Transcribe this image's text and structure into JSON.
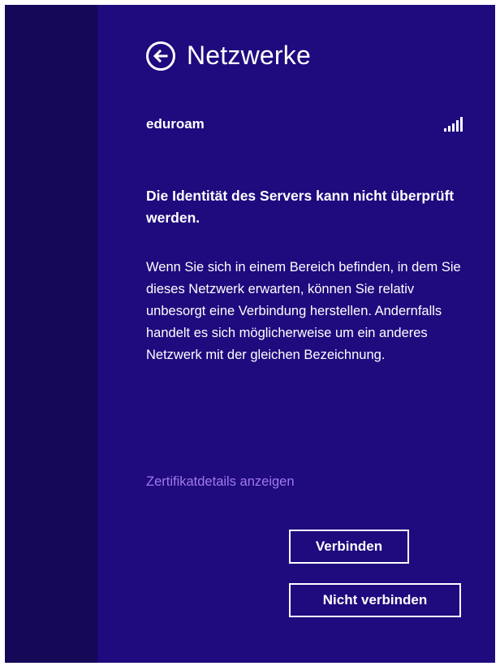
{
  "flyout": {
    "title": "Netzwerke",
    "back_icon": "back-arrow-circle-icon"
  },
  "network": {
    "name": "eduroam",
    "signal_icon": "wifi-signal-bars-icon",
    "signal_level": "5/5"
  },
  "message": {
    "heading": "Die Identität des Servers kann nicht überprüft werden.",
    "body": "Wenn Sie sich in einem Bereich befinden, in dem Sie dieses Netzwerk erwarten, können Sie relativ unbesorgt eine Verbindung herstellen. Andernfalls handelt es sich möglicherweise um ein anderes Netzwerk mit der gleichen Bezeichnung."
  },
  "links": {
    "certificate_details": "Zertifikatdetails anzeigen"
  },
  "buttons": {
    "connect": "Verbinden",
    "dont_connect": "Nicht verbinden"
  },
  "colors": {
    "flyout_background": "#1f0a7e",
    "left_strip_background": "#150857",
    "link_color": "#a07ae8",
    "text_color": "#ffffff"
  }
}
